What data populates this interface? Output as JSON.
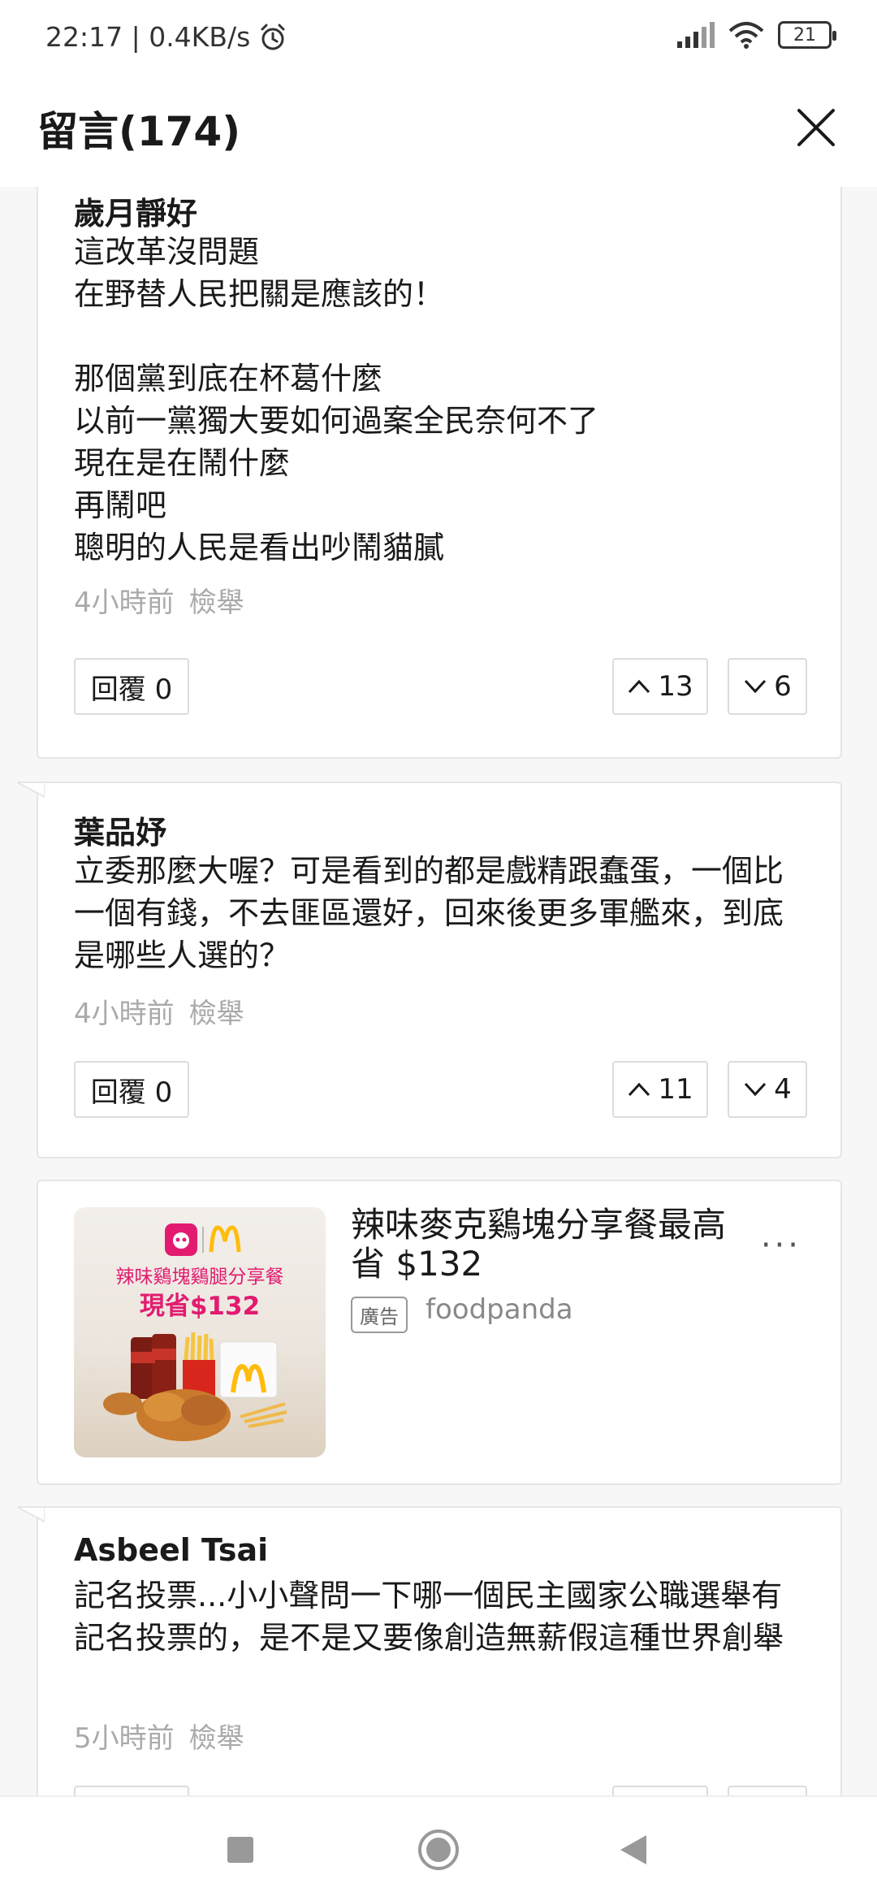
{
  "status": {
    "time": "22:17 | 0.4KB/s",
    "battery": "21"
  },
  "header": {
    "title": "留言(174)"
  },
  "comments": [
    {
      "author": "歲月靜好",
      "body": "這改革沒問題\n在野替人民把關是應該的！\n\n那個黨到底在杯葛什麼\n以前一黨獨大要如何過案全民奈何不了\n現在是在鬧什麼\n再鬧吧\n聰明的人民是看出吵鬧貓膩",
      "time": "4小時前",
      "report": "檢舉",
      "reply": "回覆 0",
      "up": "13",
      "down": "6"
    },
    {
      "author": "葉品妤",
      "body": "立委那麼大喔？可是看到的都是戲精跟蠢蛋，一個比一個有錢，不去匪區還好，回來後更多軍艦來，到底是哪些人選的？",
      "time": "4小時前",
      "report": "檢舉",
      "reply": "回覆 0",
      "up": "11",
      "down": "4"
    },
    {
      "author": "Asbeel Tsai",
      "body": "記名投票...小小聲問一下哪一個民主國家公職選舉有記名投票的，是不是又要像創造無薪假這種世界創舉",
      "time": "5小時前",
      "report": "檢舉"
    }
  ],
  "ad": {
    "title": "辣味麥克鷄塊分享餐最高省 $132",
    "badge": "廣告",
    "source": "foodpanda",
    "image_text_1": "辣味鷄塊鷄腿分享餐",
    "image_text_2": "現省$132",
    "more": "···"
  }
}
